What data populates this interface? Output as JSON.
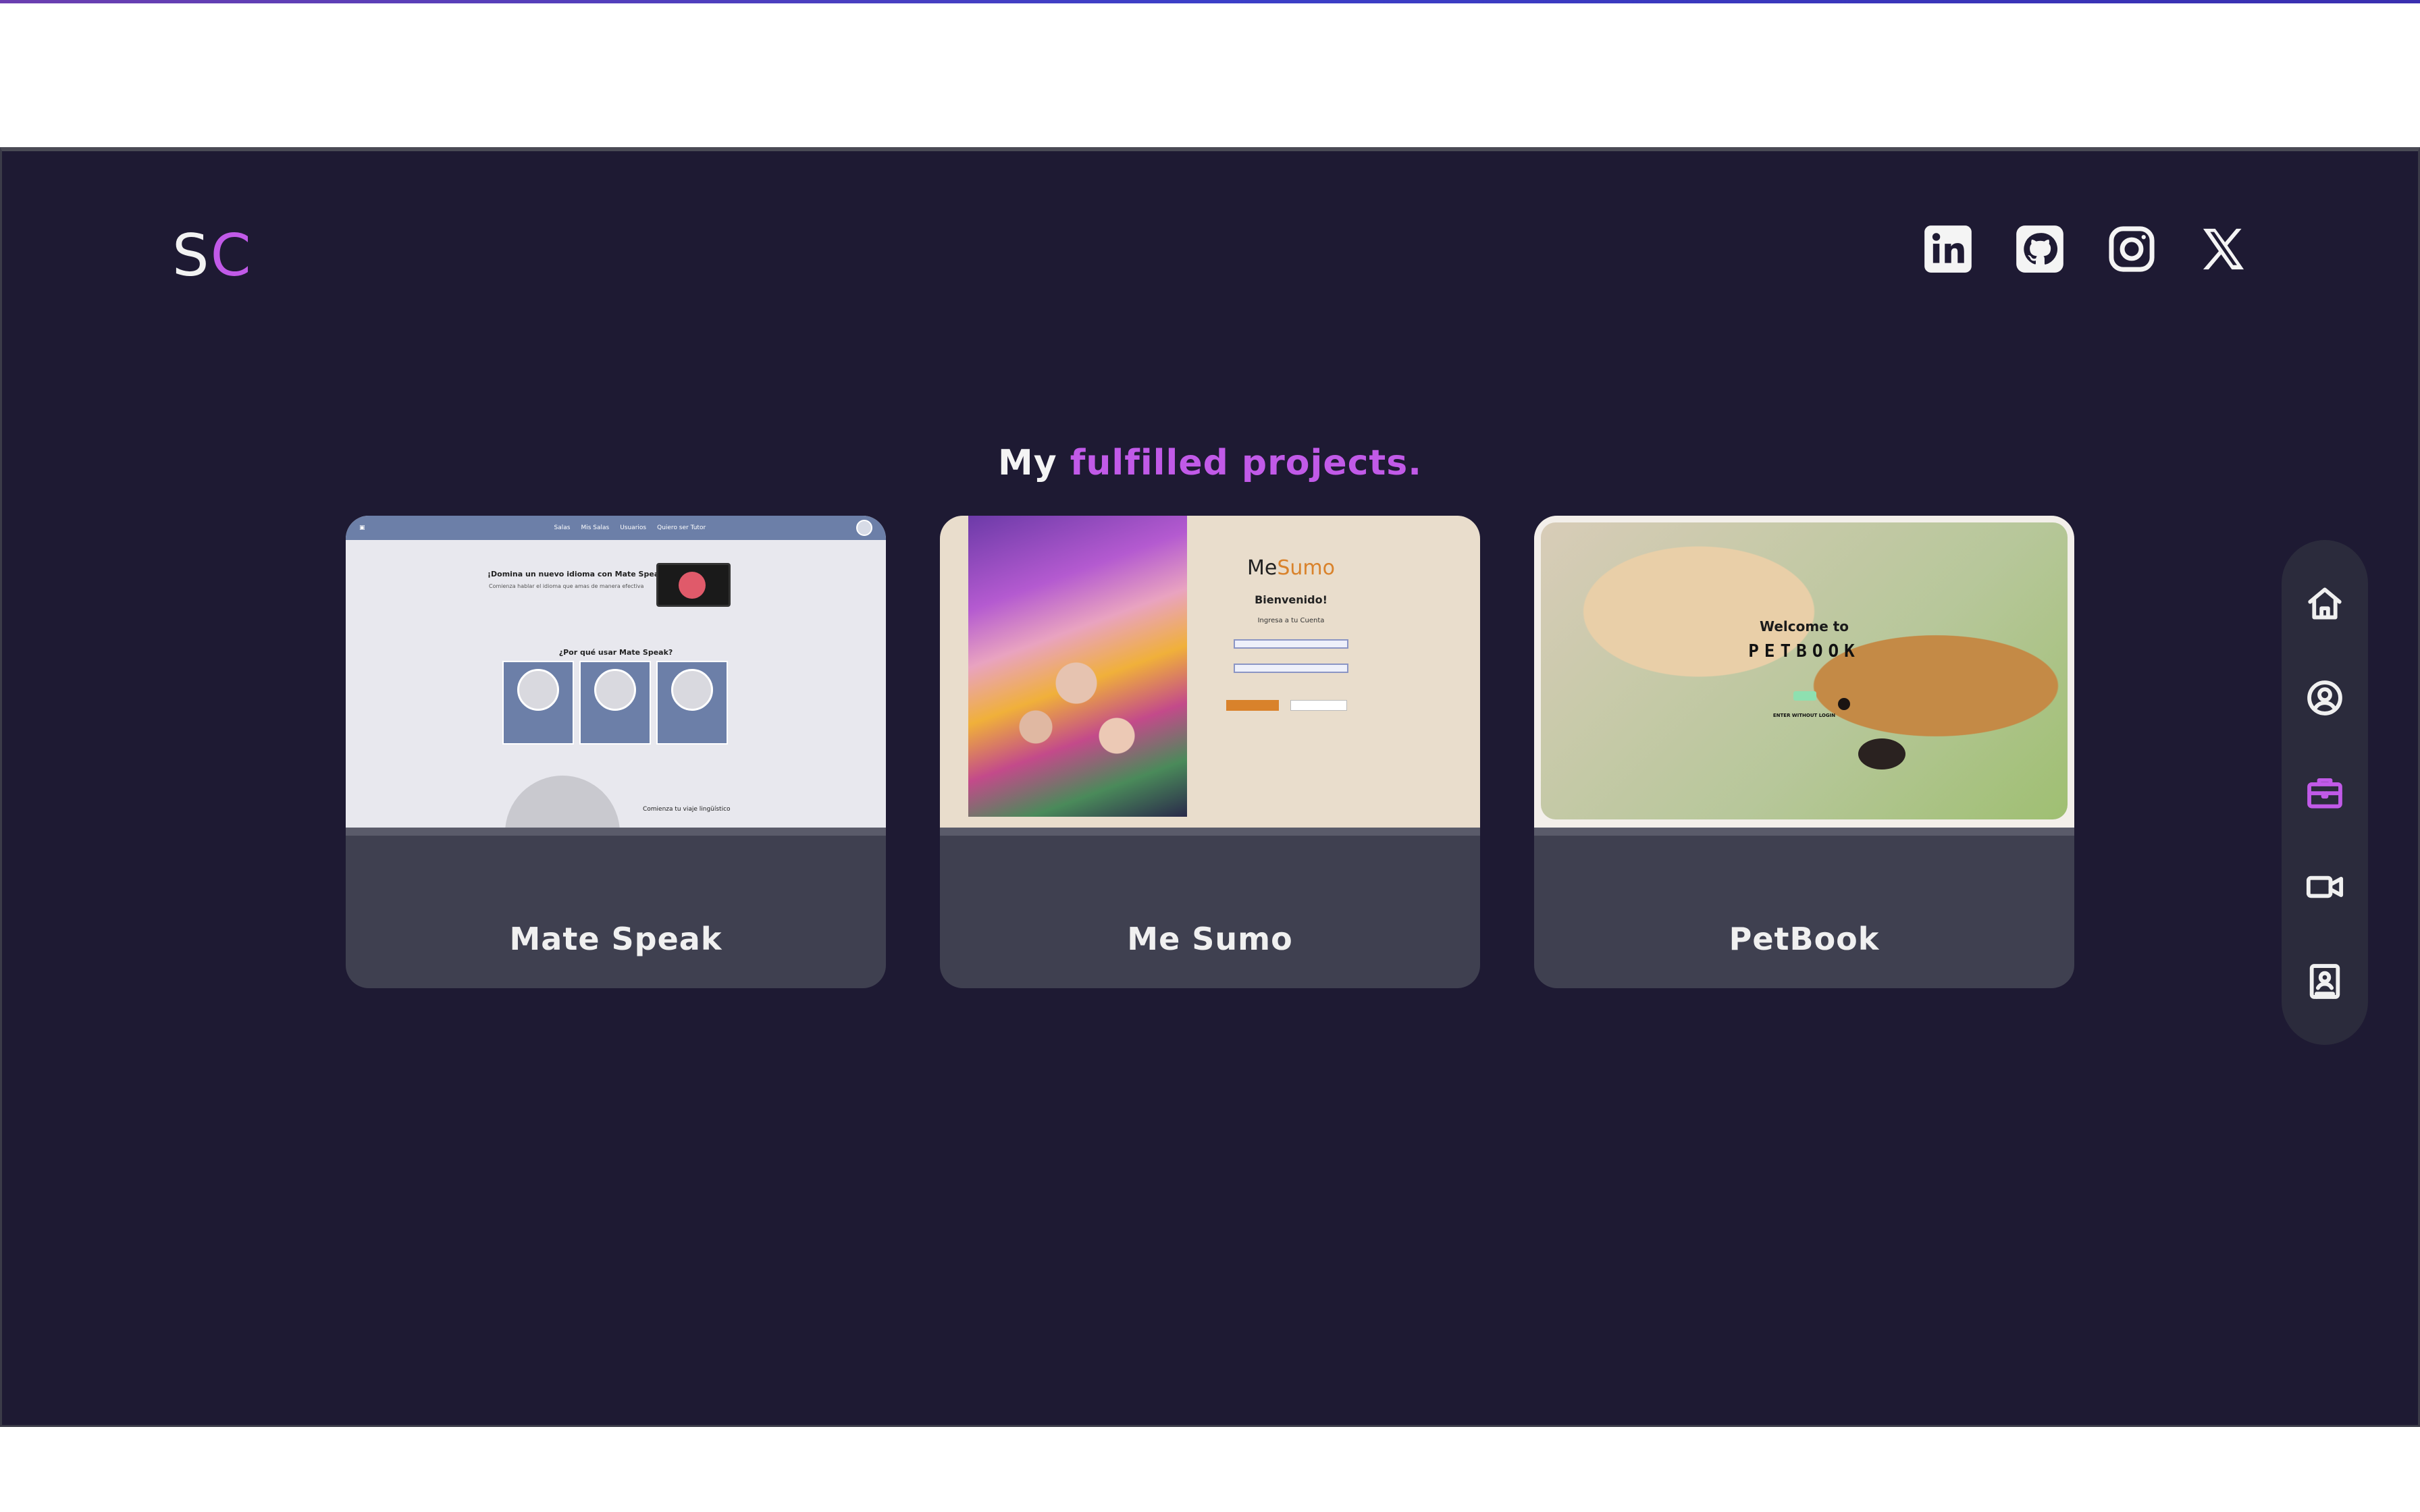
{
  "logo": {
    "first": "S",
    "second": "C"
  },
  "socials": [
    {
      "name": "linkedin-icon"
    },
    {
      "name": "github-icon"
    },
    {
      "name": "instagram-icon"
    },
    {
      "name": "x-icon"
    }
  ],
  "heading": {
    "prefix": "My",
    "accent": "fulfilled projects."
  },
  "projects": [
    {
      "title": "Mate Speak",
      "thumb": {
        "nav_links": [
          "Salas",
          "Mis Salas",
          "Usuarios",
          "Quiero ser Tutor"
        ],
        "hero_title": "¡Domina un nuevo idioma con Mate Speak!",
        "hero_sub": "Comienza hablar el idioma que amas de manera efectiva",
        "why": "¿Por qué usar Mate Speak?",
        "bottom": "Comienza tu viaje lingüístico"
      }
    },
    {
      "title": "Me Sumo",
      "thumb": {
        "brand_a": "Me",
        "brand_b": "Sumo",
        "welcome": "Bienvenido!",
        "sub": "Ingresa a tu Cuenta"
      }
    },
    {
      "title": "PetBook",
      "thumb": {
        "welcome": "Welcome to",
        "brand": "PETBOOK",
        "tiny": "ENTER WITHOUT LOGIN"
      }
    }
  ],
  "side_nav": [
    {
      "name": "home-icon",
      "active": false
    },
    {
      "name": "user-icon",
      "active": false
    },
    {
      "name": "briefcase-icon",
      "active": true
    },
    {
      "name": "video-icon",
      "active": false
    },
    {
      "name": "contact-book-icon",
      "active": false
    }
  ],
  "colors": {
    "background": "#1e1a33",
    "accent": "#c15ae8",
    "card": "#3f4050",
    "side_nav": "#2b2b3c"
  }
}
